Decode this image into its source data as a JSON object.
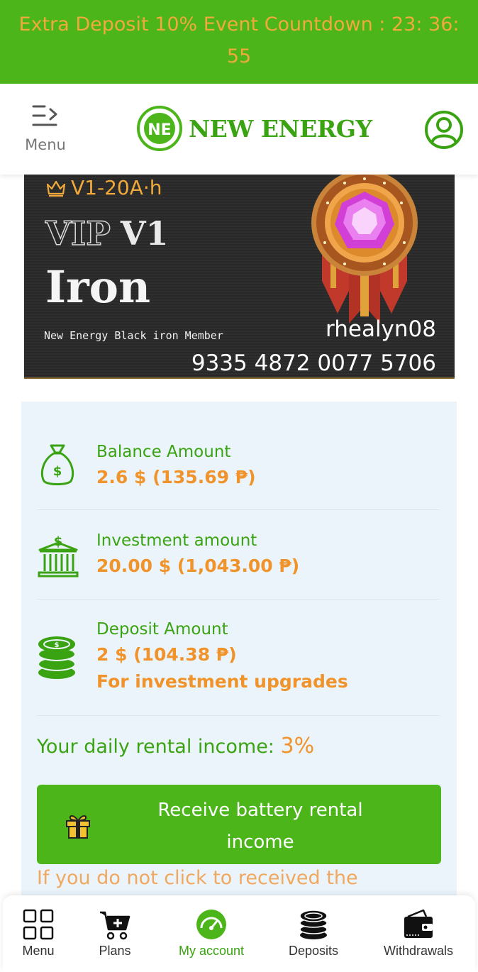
{
  "banner": {
    "text": "Extra Deposit 10% Event Countdown :   23: 36: 55"
  },
  "header": {
    "menu_label": "Menu",
    "brand_name": "NEW ENERGY",
    "brand_logo_text": "NE"
  },
  "vip_card": {
    "level": "V1-20A·h",
    "vip_word": "VIP",
    "vip_level": "V1",
    "tier": "Iron",
    "member_text": "New Energy Black iron Member",
    "username": "rhealyn08",
    "card_number": "9335 4872 0077 5706"
  },
  "stats": [
    {
      "icon": "money-bag-icon",
      "label": "Balance Amount",
      "value": "2.6 $ (135.69 ₱)"
    },
    {
      "icon": "bank-icon",
      "label": "Investment amount",
      "value": "20.00 $ (1,043.00 ₱)"
    },
    {
      "icon": "coins-icon",
      "label": "Deposit Amount",
      "value": "2 $ (104.38 ₱)",
      "note": "For investment upgrades"
    }
  ],
  "daily_income": {
    "label": "Your daily rental income: ",
    "value": "3%"
  },
  "cta": {
    "line1": "Receive battery rental",
    "line2": "income"
  },
  "note": "If you do not click to received the",
  "bottom_nav": [
    {
      "icon": "grid-icon",
      "label": "Menu",
      "active": false
    },
    {
      "icon": "cart-icon",
      "label": "Plans",
      "active": false
    },
    {
      "icon": "speedometer-icon",
      "label": "My account",
      "active": true
    },
    {
      "icon": "coins-icon",
      "label": "Deposits",
      "active": false
    },
    {
      "icon": "wallet-icon",
      "label": "Withdrawals",
      "active": false
    }
  ],
  "colors": {
    "brand_green": "#4cb51a",
    "accent_orange": "#f0932b",
    "panel_bg": "#ebf4fa"
  }
}
